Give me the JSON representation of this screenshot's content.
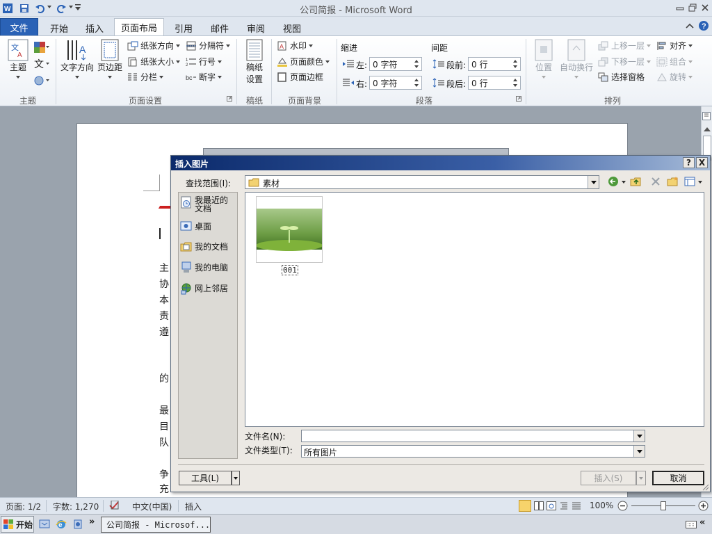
{
  "app": {
    "window_title": "公司简报 - Microsoft Word"
  },
  "tabs": [
    {
      "label": "文件"
    },
    {
      "label": "开始"
    },
    {
      "label": "插入"
    },
    {
      "label": "页面布局"
    },
    {
      "label": "引用"
    },
    {
      "label": "邮件"
    },
    {
      "label": "审阅"
    },
    {
      "label": "视图"
    }
  ],
  "ribbon": {
    "theme": {
      "big_label": "主题",
      "group_label": "主题"
    },
    "page_setup": {
      "text_direction": "文字方向",
      "margins": "页边距",
      "orientation": "纸张方向",
      "size": "纸张大小",
      "columns": "分栏",
      "breaks": "分隔符",
      "line_numbers": "行号",
      "hyphenation": "断字",
      "group_label": "页面设置"
    },
    "draft_paper": {
      "big_label": "稿纸\n设置",
      "big_label_1": "稿纸",
      "big_label_2": "设置",
      "group_label": "稿纸"
    },
    "page_background": {
      "watermark": "水印",
      "page_color": "页面颜色",
      "page_borders": "页面边框",
      "group_label": "页面背景"
    },
    "paragraph": {
      "indent_title": "缩进",
      "spacing_title": "间距",
      "left_label": "左:",
      "right_label": "右:",
      "before_label": "段前:",
      "after_label": "段后:",
      "left_value": "0 字符",
      "right_value": "0 字符",
      "before_value": "0 行",
      "after_value": "0 行",
      "group_label": "段落"
    },
    "arrange": {
      "position": "位置",
      "wrap_text": "自动换行",
      "bring_forward": "上移一层",
      "send_backward": "下移一层",
      "selection_pane": "选择窗格",
      "align": "对齐",
      "group": "组合",
      "rotate": "旋转",
      "group_label": "排列"
    }
  },
  "document": {
    "lines": [
      "（",
      "主",
      "协",
      "本",
      "责",
      "遵",
      "的",
      "最",
      "目",
      "队",
      "争",
      "充"
    ]
  },
  "dialog": {
    "title": "插入图片",
    "help_btn": "?",
    "close_btn": "X",
    "look_in_label": "查找范围(I):",
    "look_in_value": "素材",
    "places": [
      {
        "label": "我最近的文档",
        "line1": "我最近的",
        "line2": "文档"
      },
      {
        "label": "桌面",
        "line1": "桌面",
        "line2": ""
      },
      {
        "label": "我的文档",
        "line1": "我的文档",
        "line2": ""
      },
      {
        "label": "我的电脑",
        "line1": "我的电脑",
        "line2": ""
      },
      {
        "label": "网上邻居",
        "line1": "网上邻居",
        "line2": ""
      }
    ],
    "files": [
      {
        "name": "001"
      }
    ],
    "filename_label": "文件名(N):",
    "filename_value": "",
    "filetype_label": "文件类型(T):",
    "filetype_value": "所有图片",
    "tools_btn": "工具(L)",
    "insert_btn": "插入(S)",
    "cancel_btn": "取消"
  },
  "status": {
    "page": "页面: 1/2",
    "words": "字数: 1,270",
    "language": "中文(中国)",
    "mode": "插入",
    "zoom": "100%"
  },
  "taskbar": {
    "start": "开始",
    "chevron": "»",
    "window": "公司简报 - Microsof...",
    "tray_chevron": "«"
  },
  "colors": {
    "file_tab": "#2a62b6",
    "dialog_title": "#0b2a6b",
    "doc_title_red": "#cc1f1f"
  }
}
